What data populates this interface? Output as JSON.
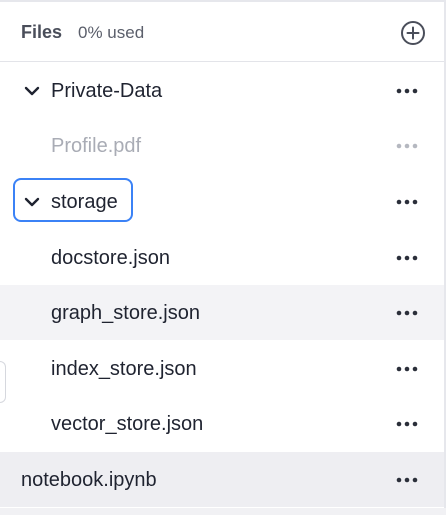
{
  "header": {
    "title": "Files",
    "usage": "0% used",
    "add_icon": "plus-circle-icon"
  },
  "tree": [
    {
      "label": "Private-Data",
      "type": "folder",
      "expanded": true,
      "depth": 0
    },
    {
      "label": "Profile.pdf",
      "type": "file",
      "muted": true,
      "depth": 1
    },
    {
      "label": "storage",
      "type": "folder",
      "expanded": true,
      "focused": true,
      "depth": 0
    },
    {
      "label": "docstore.json",
      "type": "file",
      "depth": 1
    },
    {
      "label": "graph_store.json",
      "type": "file",
      "hovered": true,
      "depth": 1
    },
    {
      "label": "index_store.json",
      "type": "file",
      "depth": 1
    },
    {
      "label": "vector_store.json",
      "type": "file",
      "depth": 1
    },
    {
      "label": "notebook.ipynb",
      "type": "file",
      "selected": true,
      "depth": -1
    }
  ],
  "colors": {
    "focus_ring": "#3b82f6",
    "hover_bg": "#f3f3f6",
    "selected_bg": "#eeeef2",
    "muted_text": "#a9acb5"
  }
}
